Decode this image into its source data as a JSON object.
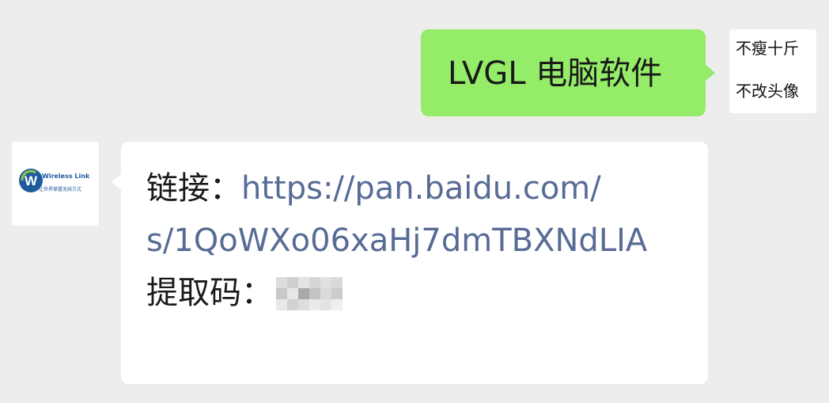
{
  "outgoing_message": {
    "text": "LVGL 电脑软件"
  },
  "self_avatar": {
    "line1": "不瘦十斤",
    "line2": "不改头像"
  },
  "peer_avatar": {
    "logo_name": "Wireless Link",
    "logo_tagline": "让世界掌握无线方式",
    "logo_letter": "W"
  },
  "incoming_message": {
    "link_label": "链接：",
    "link_url_line1": "https://pan.baidu.com/",
    "link_url_line2": "s/1QoWXo06xaHj7dmTBXNdLIA",
    "code_label": "提取码："
  },
  "colors": {
    "background": "#ededed",
    "outgoing_bubble": "#95ec69",
    "incoming_bubble": "#ffffff",
    "link": "#576b95",
    "logo": "#1e5a9e"
  }
}
